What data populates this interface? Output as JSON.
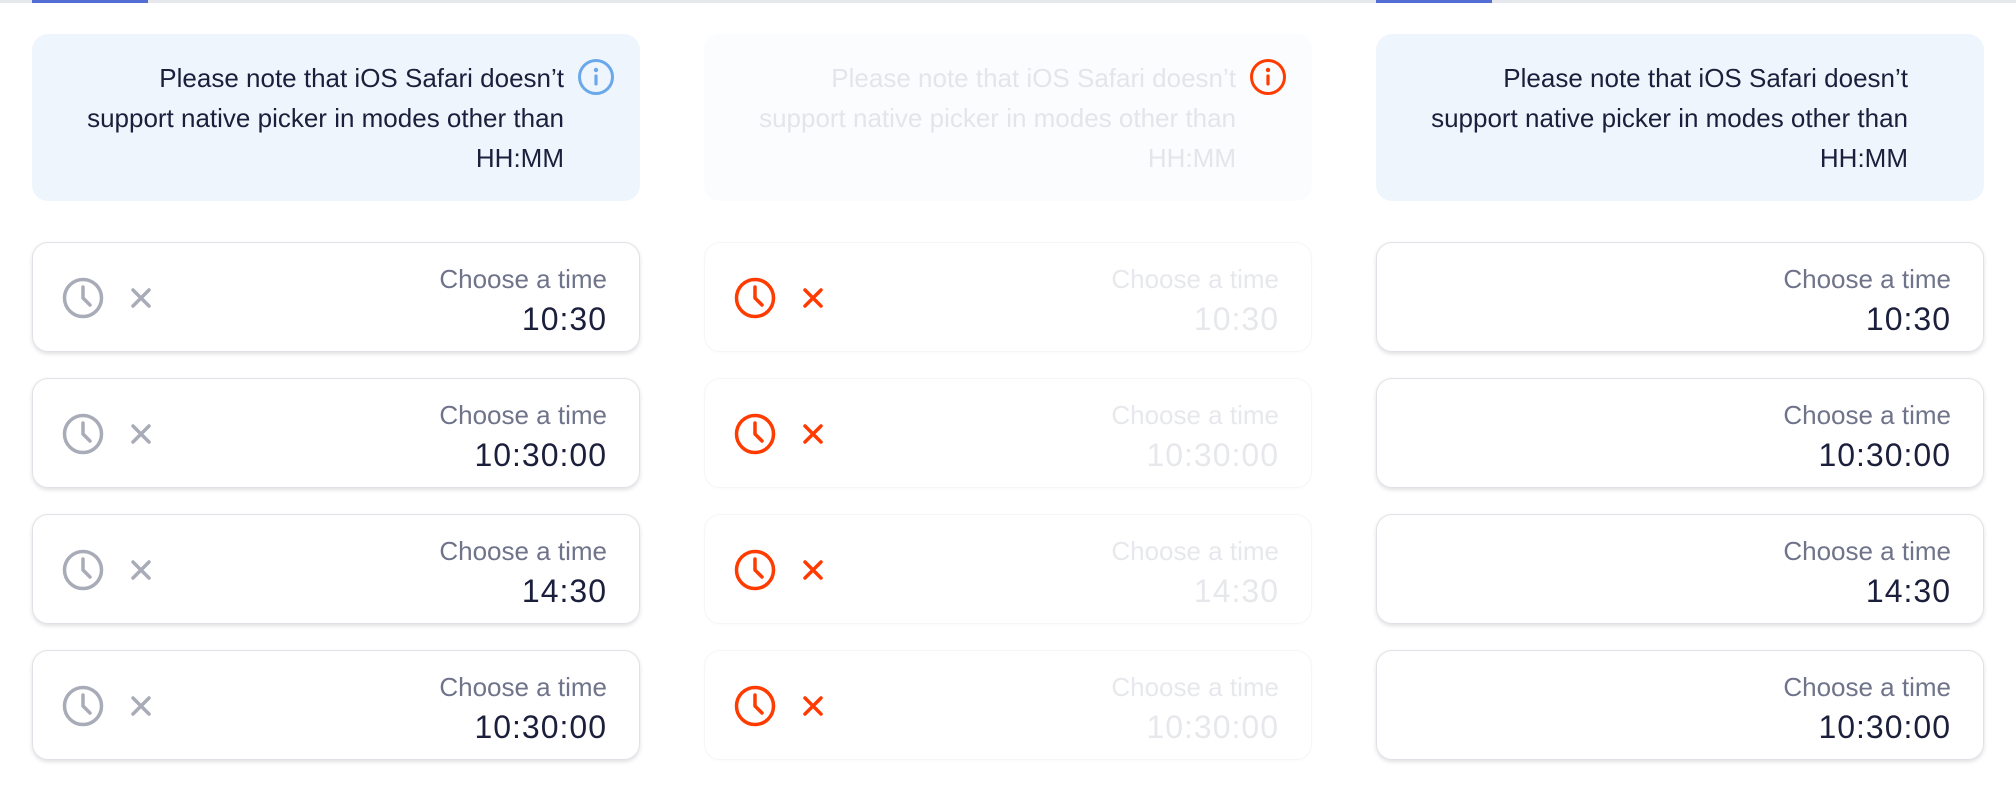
{
  "colors": {
    "accent": "#526ed3",
    "info_bg": "#eef5fd",
    "info_icon": "#6aa8ea",
    "error": "#ff3b00",
    "neutral_icon": "#a8abb8"
  },
  "panels": [
    {
      "state": "default",
      "note": "Please note that iOS Safari doesn’t support native picker in modes other than HH:MM",
      "note_icon": "info-icon",
      "fields": [
        {
          "label": "Choose a time",
          "value": "10:30"
        },
        {
          "label": "Choose a time",
          "value": "10:30:00"
        },
        {
          "label": "Choose a time",
          "value": "14:30"
        },
        {
          "label": "Choose a time",
          "value": "10:30:00"
        }
      ]
    },
    {
      "state": "disabled-error",
      "note": "Please note that iOS Safari doesn’t support native picker in modes other than HH:MM",
      "note_icon": "info-icon",
      "fields": [
        {
          "label": "Choose a time",
          "value": "10:30"
        },
        {
          "label": "Choose a time",
          "value": "10:30:00"
        },
        {
          "label": "Choose a time",
          "value": "14:30"
        },
        {
          "label": "Choose a time",
          "value": "10:30:00"
        }
      ]
    },
    {
      "state": "no-icons",
      "note": "Please note that iOS Safari doesn’t support native picker in modes other than HH:MM",
      "fields": [
        {
          "label": "Choose a time",
          "value": "10:30"
        },
        {
          "label": "Choose a time",
          "value": "10:30:00"
        },
        {
          "label": "Choose a time",
          "value": "14:30"
        },
        {
          "label": "Choose a time",
          "value": "10:30:00"
        }
      ]
    }
  ]
}
